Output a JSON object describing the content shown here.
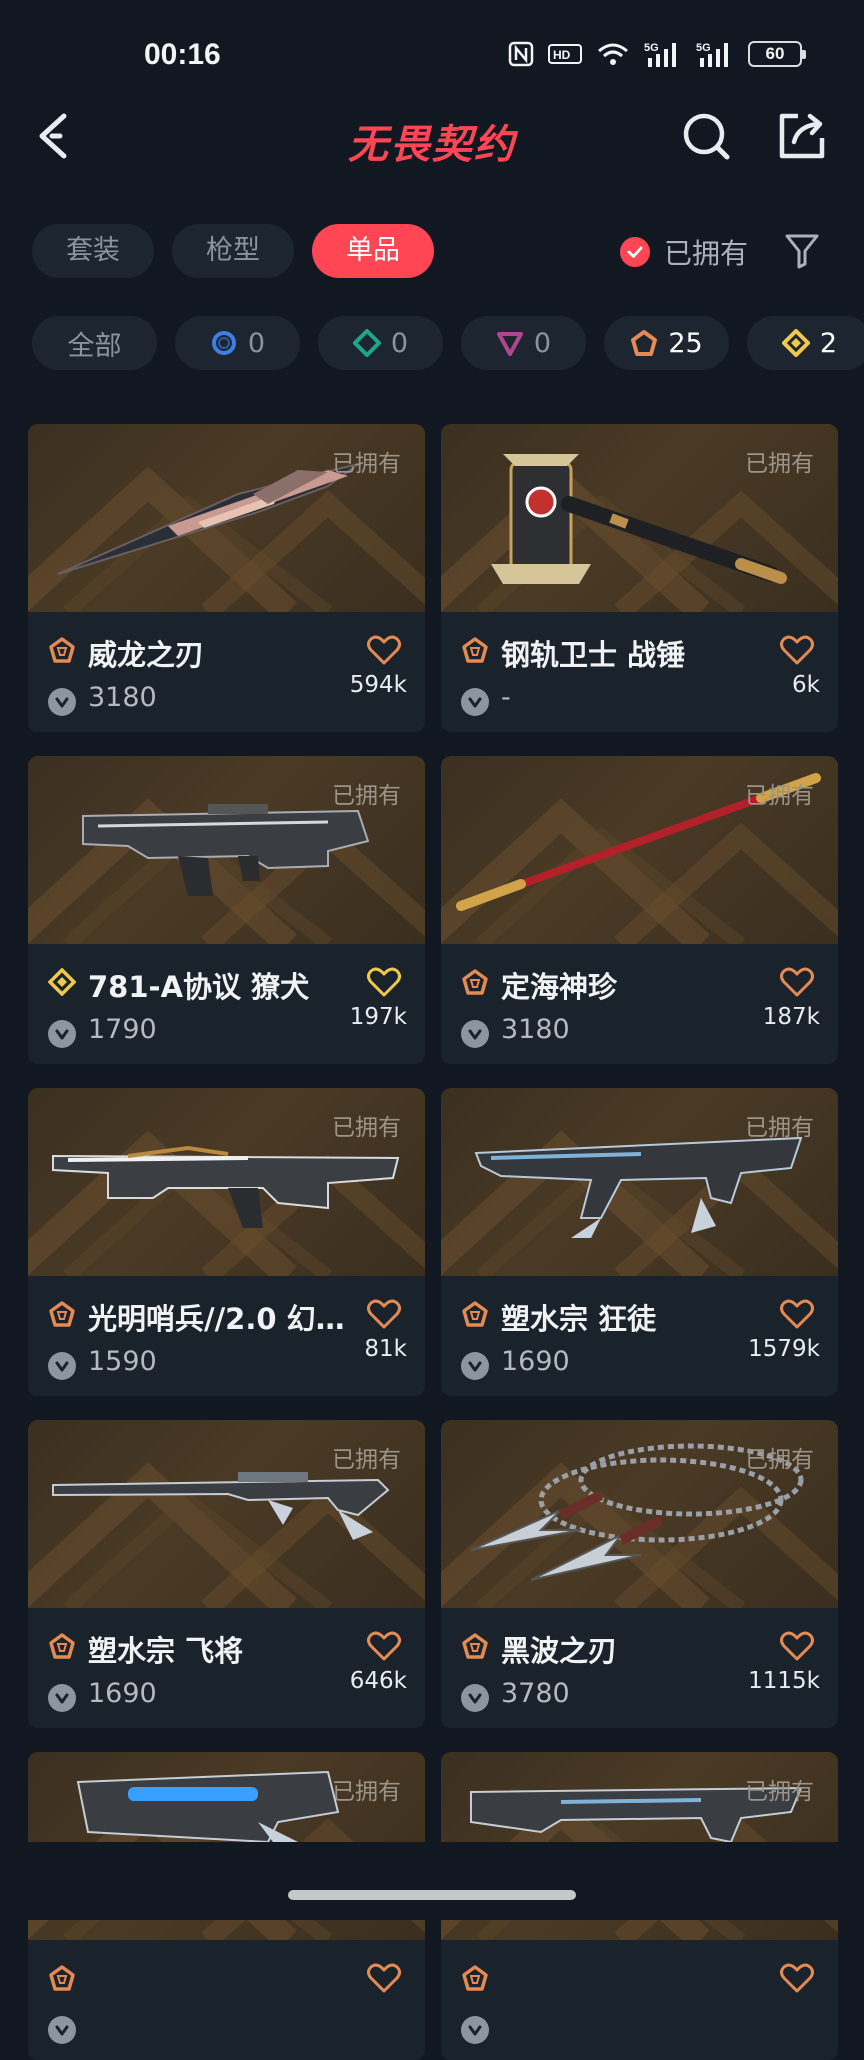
{
  "status_bar": {
    "time": "00:16",
    "battery": "60"
  },
  "header": {
    "title": "无畏契约"
  },
  "type_tabs": [
    {
      "label": "套装",
      "active": false
    },
    {
      "label": "枪型",
      "active": false
    },
    {
      "label": "单品",
      "active": true
    }
  ],
  "owned_filter": {
    "label": "已拥有",
    "checked": true
  },
  "rarity_tabs": [
    {
      "label": "全部",
      "icon": "none",
      "count": ""
    },
    {
      "icon": "select-tier-icon",
      "color": "#3e7fe0",
      "count": "0"
    },
    {
      "icon": "deluxe-tier-icon",
      "color": "#1fa68a",
      "count": "0"
    },
    {
      "icon": "premium-tier-icon",
      "color": "#b1468f",
      "count": "0"
    },
    {
      "icon": "exclusive-tier-icon",
      "color": "#e58a52",
      "count": "25"
    },
    {
      "icon": "ultra-tier-icon",
      "color": "#f0c94a",
      "count": "2"
    }
  ],
  "owned_tag": "已拥有",
  "items": [
    {
      "name": "威龙之刃",
      "tier": "exclusive",
      "tier_color": "#e58a52",
      "price": "3180",
      "likes": "594k",
      "weapon": "knife"
    },
    {
      "name": "钢轨卫士 战锤",
      "tier": "exclusive",
      "tier_color": "#e58a52",
      "price": "-",
      "likes": "6k",
      "weapon": "hammer"
    },
    {
      "name": "781-A协议 獠犬",
      "tier": "ultra",
      "tier_color": "#f0c94a",
      "price": "1790",
      "likes": "197k",
      "weapon": "smg"
    },
    {
      "name": "定海神珍",
      "tier": "exclusive",
      "tier_color": "#e58a52",
      "price": "3180",
      "likes": "187k",
      "weapon": "staff"
    },
    {
      "name": "光明哨兵//2.0 幻…",
      "tier": "exclusive",
      "tier_color": "#e58a52",
      "price": "1590",
      "likes": "81k",
      "weapon": "rifle"
    },
    {
      "name": "塑水宗 狂徒",
      "tier": "exclusive",
      "tier_color": "#e58a52",
      "price": "1690",
      "likes": "1579k",
      "weapon": "rifle2"
    },
    {
      "name": "塑水宗 飞将",
      "tier": "exclusive",
      "tier_color": "#e58a52",
      "price": "1690",
      "likes": "646k",
      "weapon": "sniper"
    },
    {
      "name": "黑波之刃",
      "tier": "exclusive",
      "tier_color": "#e58a52",
      "price": "3780",
      "likes": "1115k",
      "weapon": "chain-knife"
    },
    {
      "name": "",
      "tier": "exclusive",
      "tier_color": "#e58a52",
      "price": "",
      "likes": "",
      "weapon": "pistol"
    },
    {
      "name": "",
      "tier": "exclusive",
      "tier_color": "#e58a52",
      "price": "",
      "likes": "",
      "weapon": "rifle3"
    }
  ]
}
